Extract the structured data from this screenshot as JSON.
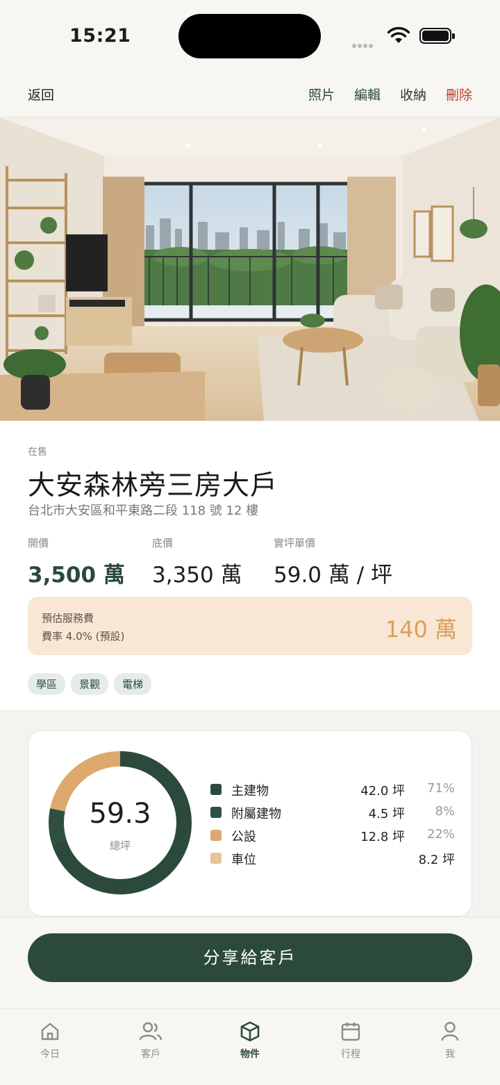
{
  "status_bar": {
    "time": "15:21"
  },
  "nav": {
    "back": "返回",
    "actions": {
      "photos": "照片",
      "edit": "編輯",
      "archive": "收納",
      "delete": "刪除"
    }
  },
  "listing": {
    "status": "在售",
    "title": "大安森林旁三房大戶",
    "address": "台北市大安區和平東路二段 118 號 12 樓",
    "prices": {
      "asking_label": "開價",
      "asking": "3,500 萬",
      "floor_label": "底價",
      "floor": "3,350 萬",
      "unit_label": "實坪單價",
      "unit": "59.0 萬 / 坪"
    },
    "fee": {
      "title": "預估服務費",
      "rate": "費率 4.0% (預設)",
      "amount": "140 萬"
    },
    "tags": [
      "學區",
      "景觀",
      "電梯"
    ]
  },
  "area": {
    "total": "59.3",
    "total_label": "總坪",
    "items": [
      {
        "name": "主建物",
        "size": "42.0 坪",
        "pct": "71%",
        "color": "#2b4a3b"
      },
      {
        "name": "附屬建物",
        "size": "4.5 坪",
        "pct": "8%",
        "color": "#2f5041"
      },
      {
        "name": "公設",
        "size": "12.8 坪",
        "pct": "22%",
        "color": "#dca86c"
      },
      {
        "name": "車位",
        "size": "8.2 坪",
        "pct": "",
        "color": "#e8c596"
      }
    ]
  },
  "cta": {
    "label": "分享給客戶"
  },
  "tabbar": {
    "tabs": [
      {
        "label": "今日",
        "icon": "home-icon"
      },
      {
        "label": "客戶",
        "icon": "users-icon"
      },
      {
        "label": "物件",
        "icon": "box-icon"
      },
      {
        "label": "行程",
        "icon": "calendar-icon"
      },
      {
        "label": "我",
        "icon": "person-icon"
      }
    ],
    "active": "物件"
  }
}
